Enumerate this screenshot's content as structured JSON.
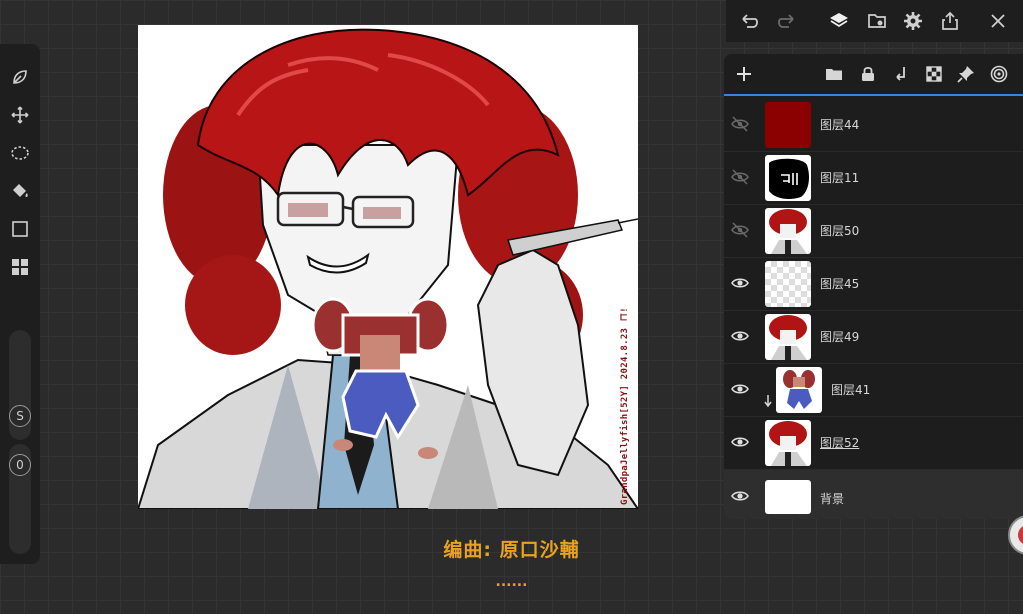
{
  "canvas": {
    "signature": "GrandpaJellyfish[52Y]  2024.8.23 コ!"
  },
  "caption": {
    "text": "编曲: 原口沙輔",
    "dots": "......"
  },
  "toolbar_icons": {
    "top": [
      "undo-icon",
      "redo-icon",
      "layers-icon",
      "import-icon",
      "gear-icon",
      "share-icon",
      "close-icon"
    ],
    "left": [
      "leaf-icon",
      "move-icon",
      "lasso-icon",
      "fill-bucket-icon",
      "rectangle-icon",
      "grid-icon"
    ]
  },
  "sliders": {
    "size_label": "S",
    "opacity_label": "0"
  },
  "layers": [
    {
      "name": "图层44",
      "visible": false,
      "thumb": "red"
    },
    {
      "name": "图层11",
      "visible": false,
      "thumb": "black"
    },
    {
      "name": "图层50",
      "visible": false,
      "thumb": "art"
    },
    {
      "name": "图层45",
      "visible": true,
      "thumb": "empty"
    },
    {
      "name": "图层49",
      "visible": true,
      "thumb": "art"
    },
    {
      "name": "图层41",
      "visible": true,
      "thumb": "doll",
      "clipped": true
    },
    {
      "name": "图层52",
      "visible": true,
      "thumb": "art",
      "underline": true
    },
    {
      "name": "背景",
      "visible": true,
      "thumb": "white",
      "selected": true
    }
  ],
  "colors": {
    "accent": "#3b82e6",
    "caption": "#e9a21d",
    "hair": "#b01414"
  }
}
